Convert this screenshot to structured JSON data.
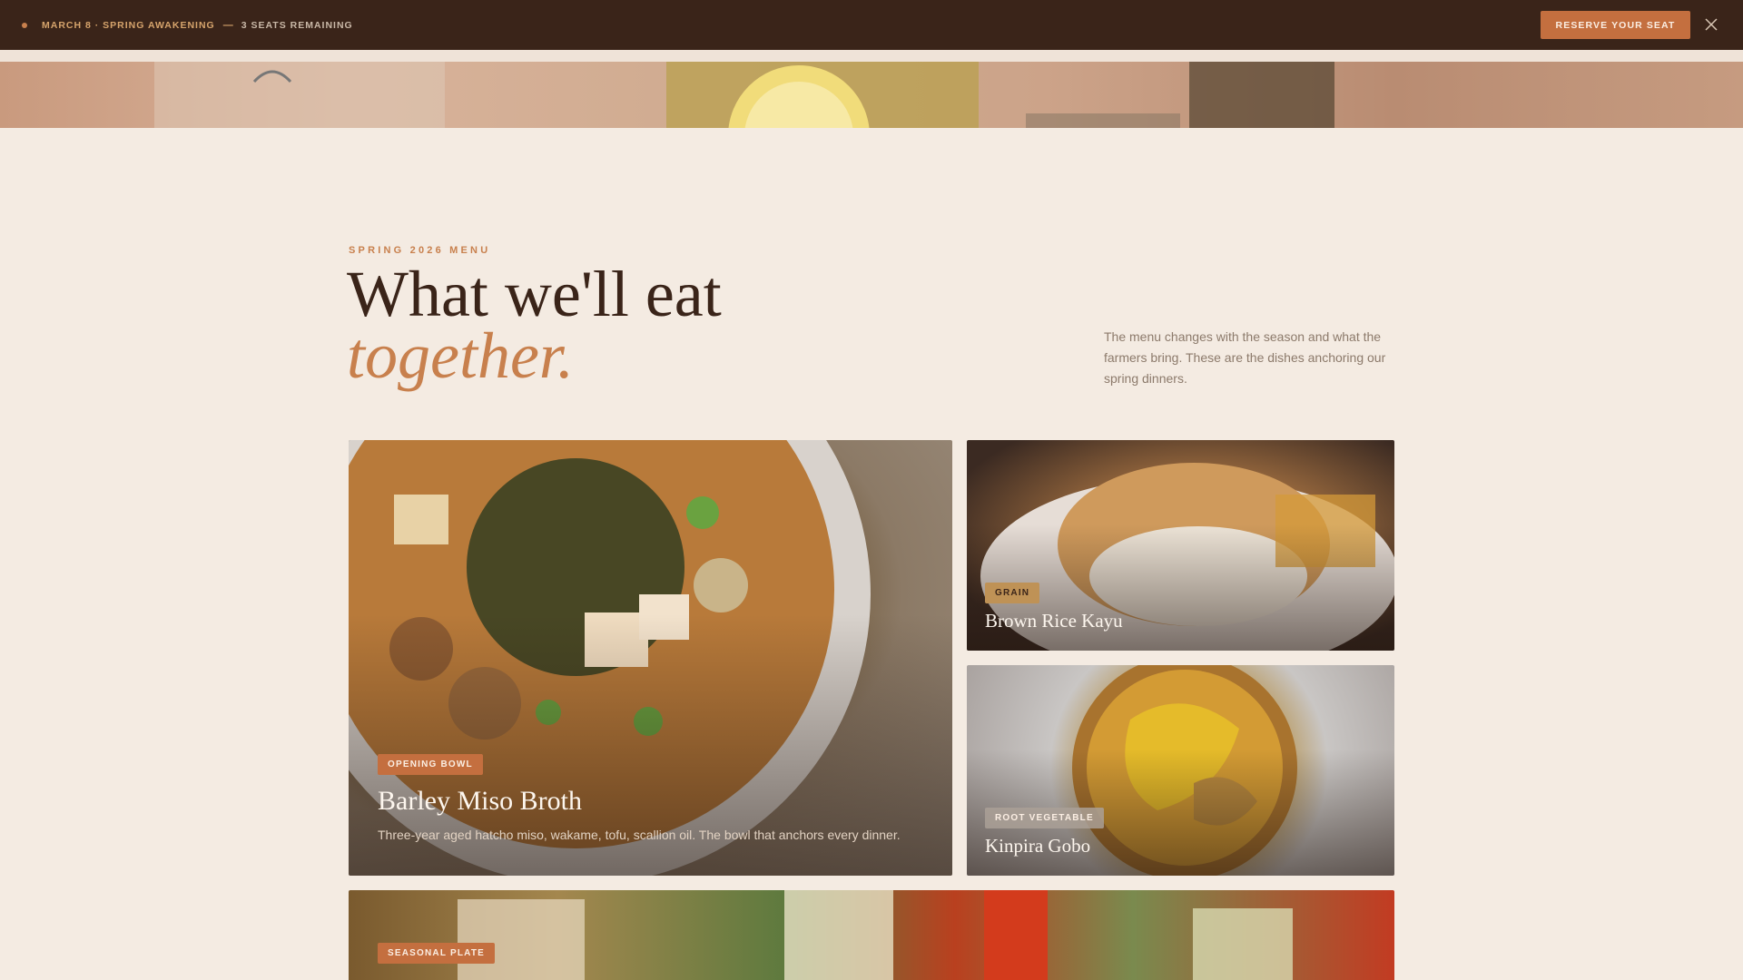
{
  "announcement": {
    "event": "MARCH 8 · SPRING AWAKENING",
    "separator": "—",
    "seats": "3 SEATS REMAINING",
    "cta_label": "RESERVE YOUR SEAT",
    "close_icon": "close-icon"
  },
  "menu": {
    "eyebrow": "SPRING 2026 MENU",
    "title_line1": "What we'll eat",
    "title_line2": "together.",
    "intro": "The menu changes with the season and what the farmers bring. These are the dishes anchoring our spring dinners."
  },
  "dishes": [
    {
      "tag": "OPENING BOWL",
      "name": "Barley Miso Broth",
      "description": "Three-year aged hatcho miso, wakame, tofu, scallion oil. The bowl that anchors every dinner."
    },
    {
      "tag": "GRAIN",
      "name": "Brown Rice Kayu"
    },
    {
      "tag": "ROOT VEGETABLE",
      "name": "Kinpira Gobo"
    },
    {
      "tag": "SEASONAL PLATE"
    }
  ],
  "colors": {
    "background": "#f4ebe2",
    "bar": "#3a2419",
    "accent": "#c8804d",
    "button": "#c46f3f"
  }
}
